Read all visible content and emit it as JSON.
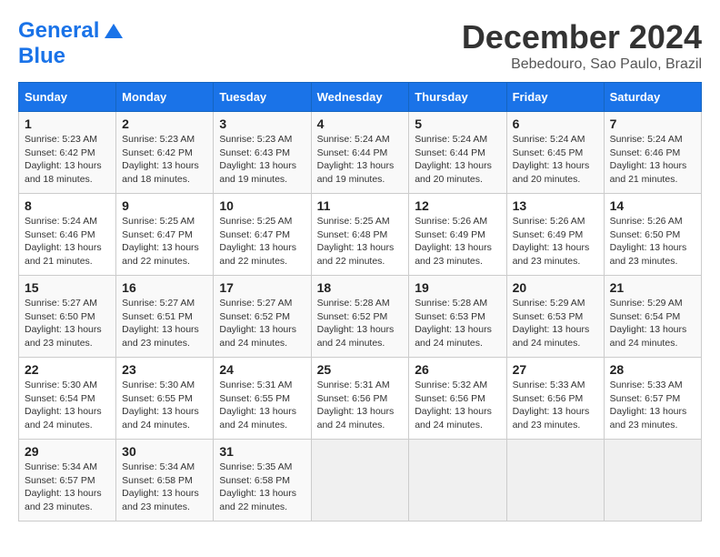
{
  "header": {
    "logo_general": "General",
    "logo_blue": "Blue",
    "main_title": "December 2024",
    "subtitle": "Bebedouro, Sao Paulo, Brazil"
  },
  "calendar": {
    "days_of_week": [
      "Sunday",
      "Monday",
      "Tuesday",
      "Wednesday",
      "Thursday",
      "Friday",
      "Saturday"
    ],
    "weeks": [
      [
        null,
        {
          "day": "2",
          "sunrise": "Sunrise: 5:23 AM",
          "sunset": "Sunset: 6:42 PM",
          "daylight": "Daylight: 13 hours and 18 minutes."
        },
        {
          "day": "3",
          "sunrise": "Sunrise: 5:23 AM",
          "sunset": "Sunset: 6:43 PM",
          "daylight": "Daylight: 13 hours and 19 minutes."
        },
        {
          "day": "4",
          "sunrise": "Sunrise: 5:24 AM",
          "sunset": "Sunset: 6:44 PM",
          "daylight": "Daylight: 13 hours and 19 minutes."
        },
        {
          "day": "5",
          "sunrise": "Sunrise: 5:24 AM",
          "sunset": "Sunset: 6:44 PM",
          "daylight": "Daylight: 13 hours and 20 minutes."
        },
        {
          "day": "6",
          "sunrise": "Sunrise: 5:24 AM",
          "sunset": "Sunset: 6:45 PM",
          "daylight": "Daylight: 13 hours and 20 minutes."
        },
        {
          "day": "7",
          "sunrise": "Sunrise: 5:24 AM",
          "sunset": "Sunset: 6:46 PM",
          "daylight": "Daylight: 13 hours and 21 minutes."
        }
      ],
      [
        {
          "day": "1",
          "sunrise": "Sunrise: 5:23 AM",
          "sunset": "Sunset: 6:42 PM",
          "daylight": "Daylight: 13 hours and 18 minutes."
        },
        null,
        null,
        null,
        null,
        null,
        null
      ],
      [
        {
          "day": "8",
          "sunrise": "Sunrise: 5:24 AM",
          "sunset": "Sunset: 6:46 PM",
          "daylight": "Daylight: 13 hours and 21 minutes."
        },
        {
          "day": "9",
          "sunrise": "Sunrise: 5:25 AM",
          "sunset": "Sunset: 6:47 PM",
          "daylight": "Daylight: 13 hours and 22 minutes."
        },
        {
          "day": "10",
          "sunrise": "Sunrise: 5:25 AM",
          "sunset": "Sunset: 6:47 PM",
          "daylight": "Daylight: 13 hours and 22 minutes."
        },
        {
          "day": "11",
          "sunrise": "Sunrise: 5:25 AM",
          "sunset": "Sunset: 6:48 PM",
          "daylight": "Daylight: 13 hours and 22 minutes."
        },
        {
          "day": "12",
          "sunrise": "Sunrise: 5:26 AM",
          "sunset": "Sunset: 6:49 PM",
          "daylight": "Daylight: 13 hours and 23 minutes."
        },
        {
          "day": "13",
          "sunrise": "Sunrise: 5:26 AM",
          "sunset": "Sunset: 6:49 PM",
          "daylight": "Daylight: 13 hours and 23 minutes."
        },
        {
          "day": "14",
          "sunrise": "Sunrise: 5:26 AM",
          "sunset": "Sunset: 6:50 PM",
          "daylight": "Daylight: 13 hours and 23 minutes."
        }
      ],
      [
        {
          "day": "15",
          "sunrise": "Sunrise: 5:27 AM",
          "sunset": "Sunset: 6:50 PM",
          "daylight": "Daylight: 13 hours and 23 minutes."
        },
        {
          "day": "16",
          "sunrise": "Sunrise: 5:27 AM",
          "sunset": "Sunset: 6:51 PM",
          "daylight": "Daylight: 13 hours and 23 minutes."
        },
        {
          "day": "17",
          "sunrise": "Sunrise: 5:27 AM",
          "sunset": "Sunset: 6:52 PM",
          "daylight": "Daylight: 13 hours and 24 minutes."
        },
        {
          "day": "18",
          "sunrise": "Sunrise: 5:28 AM",
          "sunset": "Sunset: 6:52 PM",
          "daylight": "Daylight: 13 hours and 24 minutes."
        },
        {
          "day": "19",
          "sunrise": "Sunrise: 5:28 AM",
          "sunset": "Sunset: 6:53 PM",
          "daylight": "Daylight: 13 hours and 24 minutes."
        },
        {
          "day": "20",
          "sunrise": "Sunrise: 5:29 AM",
          "sunset": "Sunset: 6:53 PM",
          "daylight": "Daylight: 13 hours and 24 minutes."
        },
        {
          "day": "21",
          "sunrise": "Sunrise: 5:29 AM",
          "sunset": "Sunset: 6:54 PM",
          "daylight": "Daylight: 13 hours and 24 minutes."
        }
      ],
      [
        {
          "day": "22",
          "sunrise": "Sunrise: 5:30 AM",
          "sunset": "Sunset: 6:54 PM",
          "daylight": "Daylight: 13 hours and 24 minutes."
        },
        {
          "day": "23",
          "sunrise": "Sunrise: 5:30 AM",
          "sunset": "Sunset: 6:55 PM",
          "daylight": "Daylight: 13 hours and 24 minutes."
        },
        {
          "day": "24",
          "sunrise": "Sunrise: 5:31 AM",
          "sunset": "Sunset: 6:55 PM",
          "daylight": "Daylight: 13 hours and 24 minutes."
        },
        {
          "day": "25",
          "sunrise": "Sunrise: 5:31 AM",
          "sunset": "Sunset: 6:56 PM",
          "daylight": "Daylight: 13 hours and 24 minutes."
        },
        {
          "day": "26",
          "sunrise": "Sunrise: 5:32 AM",
          "sunset": "Sunset: 6:56 PM",
          "daylight": "Daylight: 13 hours and 24 minutes."
        },
        {
          "day": "27",
          "sunrise": "Sunrise: 5:33 AM",
          "sunset": "Sunset: 6:56 PM",
          "daylight": "Daylight: 13 hours and 23 minutes."
        },
        {
          "day": "28",
          "sunrise": "Sunrise: 5:33 AM",
          "sunset": "Sunset: 6:57 PM",
          "daylight": "Daylight: 13 hours and 23 minutes."
        }
      ],
      [
        {
          "day": "29",
          "sunrise": "Sunrise: 5:34 AM",
          "sunset": "Sunset: 6:57 PM",
          "daylight": "Daylight: 13 hours and 23 minutes."
        },
        {
          "day": "30",
          "sunrise": "Sunrise: 5:34 AM",
          "sunset": "Sunset: 6:58 PM",
          "daylight": "Daylight: 13 hours and 23 minutes."
        },
        {
          "day": "31",
          "sunrise": "Sunrise: 5:35 AM",
          "sunset": "Sunset: 6:58 PM",
          "daylight": "Daylight: 13 hours and 22 minutes."
        },
        null,
        null,
        null,
        null
      ]
    ]
  }
}
